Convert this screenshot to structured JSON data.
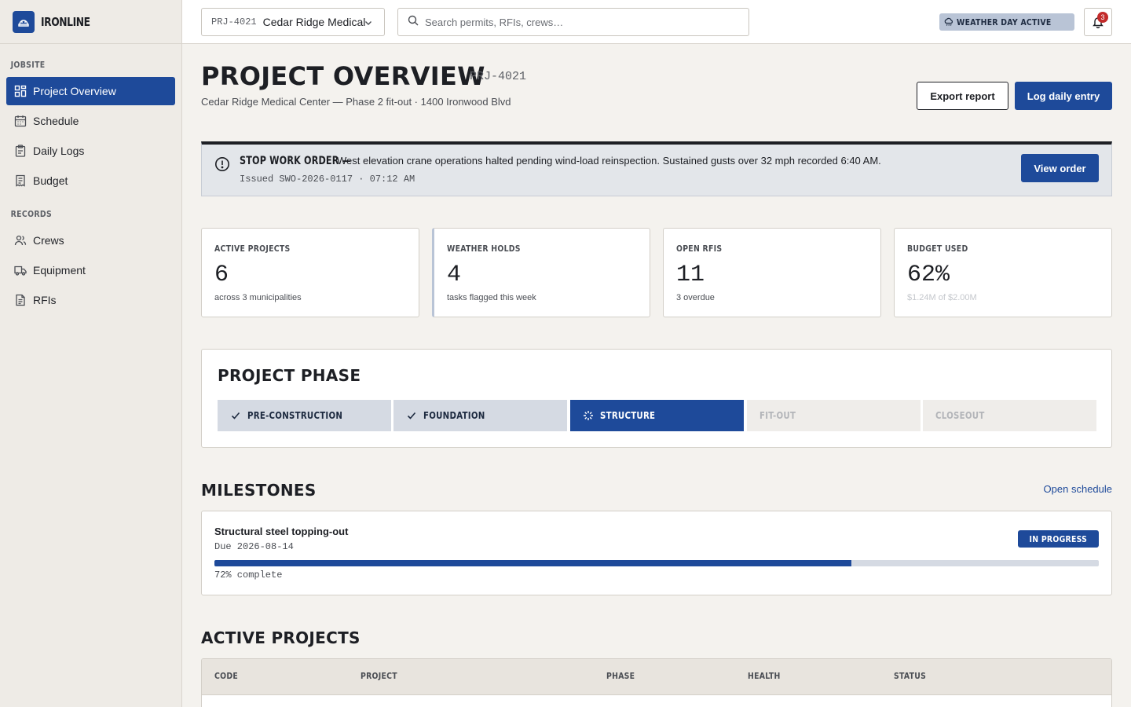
{
  "brand": {
    "name": "IRONLINE"
  },
  "sidebar": {
    "sections": [
      {
        "title": "JOBSITE",
        "items": [
          {
            "label": "Project Overview",
            "icon": "grid-icon",
            "active": true
          },
          {
            "label": "Schedule",
            "icon": "calendar-icon"
          },
          {
            "label": "Daily Logs",
            "icon": "clipboard-icon"
          },
          {
            "label": "Budget",
            "icon": "receipt-icon"
          }
        ]
      },
      {
        "title": "RECORDS",
        "items": [
          {
            "label": "Crews",
            "icon": "users-icon"
          },
          {
            "label": "Equipment",
            "icon": "truck-icon"
          },
          {
            "label": "RFIs",
            "icon": "document-icon"
          }
        ]
      }
    ]
  },
  "topbar": {
    "project_code": "PRJ-4021",
    "project_name": "Cedar Ridge Medical",
    "search_placeholder": "Search permits, RFIs, crews…",
    "weather_badge": "WEATHER DAY ACTIVE",
    "notification_count": "3"
  },
  "header": {
    "title": "PROJECT OVERVIEW",
    "code": "PRJ-4021",
    "subtitle": "Cedar Ridge Medical Center — Phase 2 fit-out · 1400 Ironwood Blvd",
    "export_label": "Export report",
    "log_label": "Log daily entry"
  },
  "alert": {
    "title": "STOP WORK ORDER —",
    "message": "West elevation crane operations halted pending wind-load reinspection. Sustained gusts over 32 mph recorded 6:40 AM.",
    "meta": "Issued SWO-2026-0117 · 07:12 AM",
    "button": "View order"
  },
  "stats": [
    {
      "label": "ACTIVE PROJECTS",
      "value": "6",
      "sub": "across 3 municipalities"
    },
    {
      "label": "WEATHER HOLDS",
      "value": "4",
      "sub": "tasks flagged this week"
    },
    {
      "label": "OPEN RFIS",
      "value": "11",
      "sub": "3 overdue"
    },
    {
      "label": "BUDGET USED",
      "value": "62%",
      "sub": "$1.24M of $2.00M"
    }
  ],
  "phase": {
    "title": "PROJECT PHASE",
    "steps": [
      {
        "label": "PRE-CONSTRUCTION",
        "state": "done"
      },
      {
        "label": "FOUNDATION",
        "state": "done"
      },
      {
        "label": "STRUCTURE",
        "state": "current"
      },
      {
        "label": "FIT-OUT",
        "state": "todo"
      },
      {
        "label": "CLOSEOUT",
        "state": "todo"
      }
    ]
  },
  "milestones": {
    "title": "MILESTONES",
    "link": "Open schedule",
    "items": [
      {
        "title": "Structural steel topping-out",
        "due": "Due 2026-08-14",
        "status": "IN PROGRESS",
        "progress": 0.72,
        "progress_label": "72% complete"
      }
    ]
  },
  "projects": {
    "title": "ACTIVE PROJECTS",
    "columns": [
      "CODE",
      "PROJECT",
      "PHASE",
      "HEALTH",
      "STATUS"
    ]
  },
  "colors": {
    "accent": "#1e4a9a",
    "alert_bar": "#1d1f24",
    "badge_red": "#c32b2b"
  }
}
